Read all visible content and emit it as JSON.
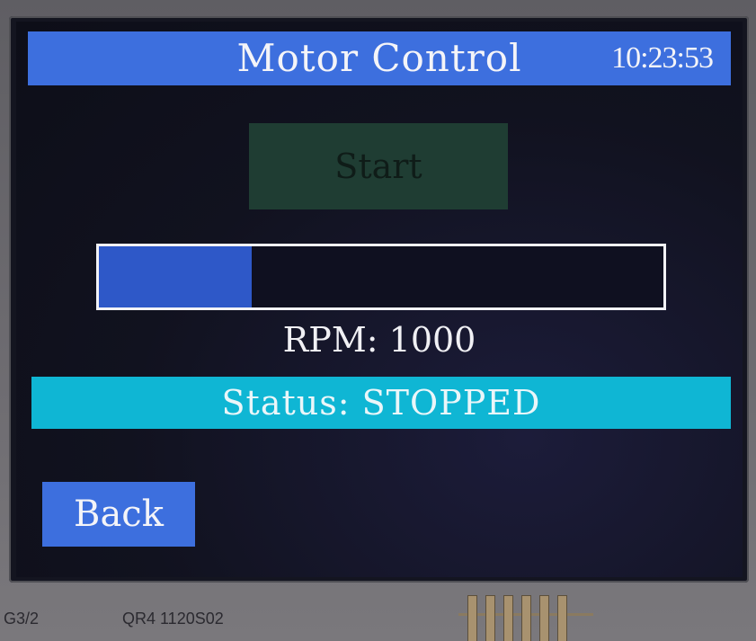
{
  "header": {
    "title": "Motor Control",
    "time": "10:23:53"
  },
  "controls": {
    "start_label": "Start",
    "back_label": "Back"
  },
  "progress": {
    "fraction": 0.27
  },
  "readout": {
    "rpm_label": "RPM:",
    "rpm_value": "1000"
  },
  "status": {
    "text": "Status: STOPPED"
  },
  "board": {
    "label_left": "G3/2",
    "label_mid": "QR4 1120S02"
  },
  "colors": {
    "title_bar": "#3d6fde",
    "status_bar": "#0fb6d4",
    "progress_fill": "#2e58c8",
    "start_button": "#1f3d33",
    "back_button": "#3d6fde"
  }
}
